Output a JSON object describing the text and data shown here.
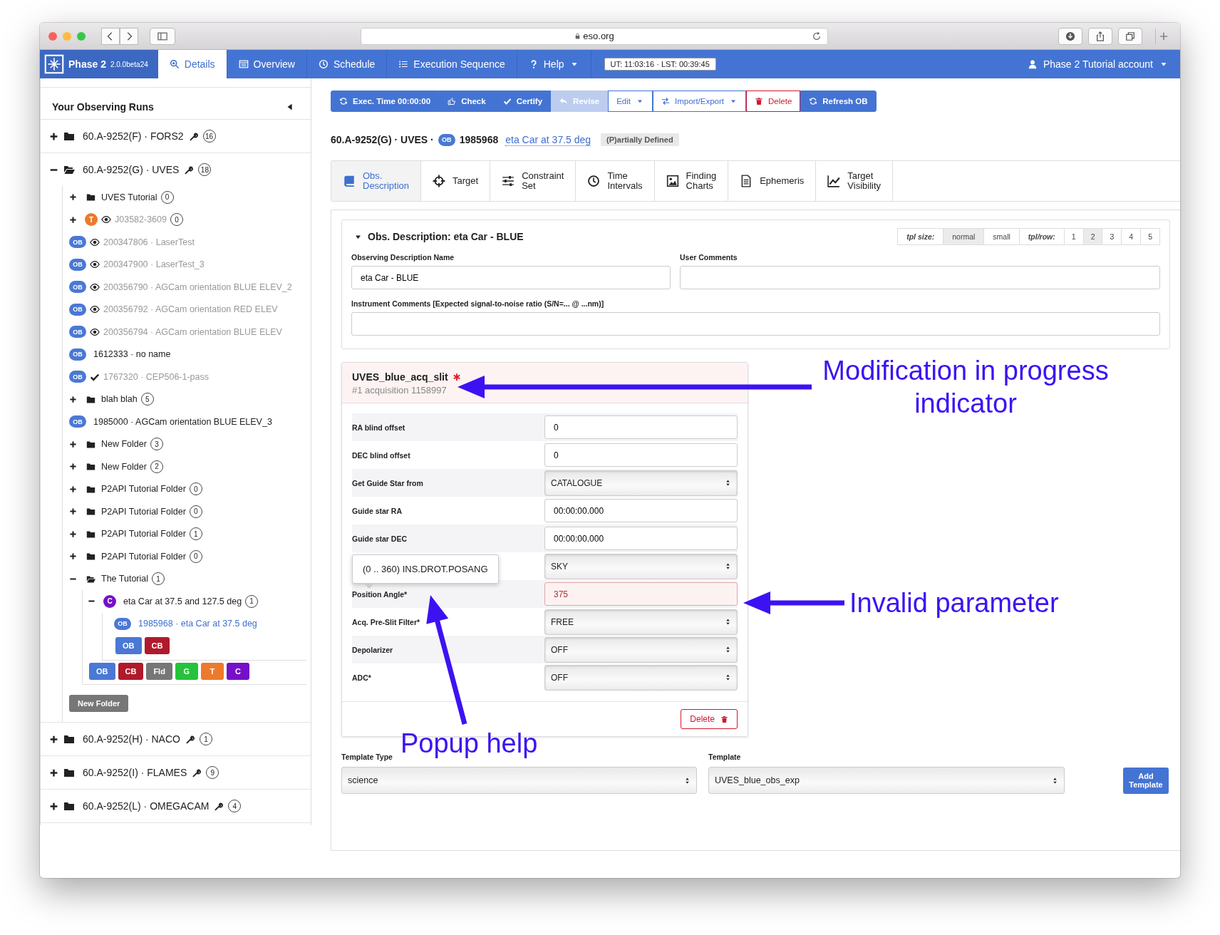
{
  "browser": {
    "url": "eso.org"
  },
  "navbar": {
    "brand": "Phase 2",
    "version": "2.0.0beta24",
    "tabs": [
      {
        "label": "Details",
        "selected": true,
        "dropdown": false
      },
      {
        "label": "Overview",
        "selected": false,
        "dropdown": false
      },
      {
        "label": "Schedule",
        "selected": false,
        "dropdown": false
      },
      {
        "label": "Execution Sequence",
        "selected": false,
        "dropdown": false
      },
      {
        "label": "Help",
        "selected": false,
        "dropdown": true
      }
    ],
    "clock": "UT: 11:03:16 · LST: 00:39:45",
    "account": "Phase 2 Tutorial account"
  },
  "sidebar": {
    "title": "Your Observing Runs",
    "runs": [
      {
        "label": "60.A-9252(F) · FORS2",
        "count": "16",
        "expanded": false
      },
      {
        "label": "60.A-9252(G) · UVES",
        "count": "18",
        "expanded": true,
        "new_folder": "New Folder",
        "children": [
          {
            "kind": "folder",
            "label": "UVES Tutorial",
            "count": "0",
            "expanded": false
          },
          {
            "kind": "container",
            "badge": "T",
            "color": "#ec7a2c",
            "hidden": true,
            "certified": false,
            "greyed": true,
            "label": "J03582-3609",
            "count": "0",
            "expanded": false
          },
          {
            "kind": "ob",
            "badge": "OB",
            "hidden": true,
            "certified": false,
            "greyed": true,
            "selected": false,
            "label": "200347806 · LaserTest"
          },
          {
            "kind": "ob",
            "badge": "OB",
            "hidden": true,
            "certified": false,
            "greyed": true,
            "selected": false,
            "label": "200347900 · LaserTest_3"
          },
          {
            "kind": "ob",
            "badge": "OB",
            "hidden": true,
            "certified": false,
            "greyed": true,
            "selected": false,
            "label": "200356790 · AGCam orientation BLUE ELEV_2"
          },
          {
            "kind": "ob",
            "badge": "OB",
            "hidden": true,
            "certified": false,
            "greyed": true,
            "selected": false,
            "label": "200356792 · AGCam orientation RED ELEV"
          },
          {
            "kind": "ob",
            "badge": "OB",
            "hidden": true,
            "certified": false,
            "greyed": true,
            "selected": false,
            "label": "200356794 · AGCam orientation BLUE ELEV"
          },
          {
            "kind": "ob",
            "badge": "OB",
            "hidden": false,
            "certified": false,
            "greyed": false,
            "selected": false,
            "label": "1612333 · no name"
          },
          {
            "kind": "ob",
            "badge": "OB",
            "hidden": false,
            "certified": true,
            "greyed": true,
            "selected": false,
            "label": "1767320 · CEP506-1-pass"
          },
          {
            "kind": "folder",
            "label": "blah blah",
            "count": "5",
            "expanded": false
          },
          {
            "kind": "ob",
            "badge": "OB",
            "hidden": false,
            "certified": false,
            "greyed": false,
            "selected": false,
            "label": "1985000 · AGCam orientation BLUE ELEV_3"
          },
          {
            "kind": "folder",
            "label": "New Folder",
            "count": "3",
            "expanded": false
          },
          {
            "kind": "folder",
            "label": "New Folder",
            "count": "2",
            "expanded": false
          },
          {
            "kind": "folder",
            "label": "P2API Tutorial Folder",
            "count": "0",
            "expanded": false
          },
          {
            "kind": "folder",
            "label": "P2API Tutorial Folder",
            "count": "0",
            "expanded": false
          },
          {
            "kind": "folder",
            "label": "P2API Tutorial Folder",
            "count": "1",
            "expanded": false
          },
          {
            "kind": "folder",
            "label": "P2API Tutorial Folder",
            "count": "0",
            "expanded": false
          },
          {
            "kind": "folder",
            "label": "The Tutorial",
            "count": "1",
            "expanded": true,
            "children": [
              {
                "kind": "container",
                "badge": "C",
                "color": "#7510c8",
                "hidden": false,
                "certified": false,
                "greyed": false,
                "label": "eta Car at 37.5 and 127.5 deg",
                "count": "1",
                "expanded": true,
                "children": [
                  {
                    "kind": "ob",
                    "badge": "OB",
                    "hidden": false,
                    "certified": false,
                    "greyed": false,
                    "selected": true,
                    "label": "1985968 · eta Car at 37.5 deg"
                  }
                ],
                "buttons": [
                  {
                    "label": "OB",
                    "color": "#4a78d4"
                  },
                  {
                    "label": "CB",
                    "color": "#b01a2c"
                  }
                ]
              }
            ],
            "buttons": [
              {
                "label": "OB",
                "color": "#4a78d4"
              },
              {
                "label": "CB",
                "color": "#b01a2c"
              },
              {
                "label": "Fld",
                "color": "#777777"
              },
              {
                "label": "G",
                "color": "#27c23c"
              },
              {
                "label": "T",
                "color": "#ec7a2c"
              },
              {
                "label": "C",
                "color": "#7510c8"
              }
            ]
          }
        ]
      },
      {
        "label": "60.A-9252(H) · NACO",
        "count": "1",
        "expanded": false
      },
      {
        "label": "60.A-9252(I) · FLAMES",
        "count": "9",
        "expanded": false
      },
      {
        "label": "60.A-9252(L) · OMEGACAM",
        "count": "4",
        "expanded": false
      }
    ]
  },
  "toolbar": [
    {
      "label": "Exec. Time 00:00:00",
      "kind": "primary",
      "disabled": false
    },
    {
      "label": "Check",
      "kind": "primary",
      "disabled": false
    },
    {
      "label": "Certify",
      "kind": "primary",
      "disabled": false
    },
    {
      "label": "Revise",
      "kind": "primary",
      "disabled": true
    },
    {
      "label": "Edit",
      "kind": "dropdown",
      "disabled": false
    },
    {
      "label": "Import/Export",
      "kind": "dropdown",
      "disabled": false
    },
    {
      "label": "Delete",
      "kind": "danger",
      "disabled": false
    },
    {
      "label": "Refresh OB",
      "kind": "primary",
      "disabled": false
    }
  ],
  "header": {
    "run": "60.A-9252(G) · UVES ·",
    "badge": "OB",
    "ob_id": "1985968",
    "ob_name": "eta Car at 37.5 deg",
    "status": "(P)artially Defined"
  },
  "tabs": [
    {
      "label": "Obs. Description",
      "selected": true
    },
    {
      "label": "Target",
      "selected": false
    },
    {
      "label": "Constraint Set",
      "selected": false
    },
    {
      "label": "Time Intervals",
      "selected": false
    },
    {
      "label": "Finding Charts",
      "selected": false
    },
    {
      "label": "Ephemeris",
      "selected": false
    },
    {
      "label": "Target Visibility",
      "selected": false
    }
  ],
  "obs_description": {
    "title": "Obs. Description: eta Car - BLUE",
    "expanded": true,
    "tpl_size": {
      "label": "tpl size:",
      "options": [
        {
          "label": "normal",
          "selected": true
        },
        {
          "label": "small",
          "selected": false
        }
      ]
    },
    "tpl_row": {
      "label": "tpl/row:",
      "options": [
        {
          "label": "1",
          "selected": false
        },
        {
          "label": "2",
          "selected": true
        },
        {
          "label": "3",
          "selected": false
        },
        {
          "label": "4",
          "selected": false
        },
        {
          "label": "5",
          "selected": false
        }
      ]
    },
    "name": {
      "label": "Observing Description Name",
      "value": "eta Car - BLUE"
    },
    "user_comments": {
      "label": "User Comments"
    },
    "instrument_comments": {
      "label": "Instrument Comments [Expected signal-to-noise ratio (S/N=... @ ...nm)]"
    }
  },
  "template": {
    "title": "UVES_blue_acq_slit",
    "modified": true,
    "subtitle": "#1 acquisition 1158997",
    "params": [
      {
        "label": "RA blind offset",
        "kind": "input",
        "value": "0",
        "invalid": false
      },
      {
        "label": "DEC blind offset",
        "kind": "input",
        "value": "0",
        "invalid": false
      },
      {
        "label": "Get Guide Star from",
        "kind": "select",
        "value": "CATALOGUE",
        "invalid": false
      },
      {
        "label": "Guide star RA",
        "kind": "input",
        "value": "00:00:00.000",
        "invalid": false
      },
      {
        "label": "Guide star DEC",
        "kind": "input",
        "value": "00:00:00.000",
        "invalid": false
      },
      {
        "kind": "select",
        "value": "SKY",
        "invalid": false
      },
      {
        "label": "Position Angle*",
        "kind": "input",
        "value": "375",
        "invalid": true,
        "help": "(0 .. 360) INS.DROT.POSANG"
      },
      {
        "label": "Acq. Pre-Slit Filter*",
        "kind": "select",
        "value": "FREE",
        "invalid": false
      },
      {
        "label": "Depolarizer",
        "kind": "select",
        "value": "OFF",
        "invalid": false
      },
      {
        "label": "ADC*",
        "kind": "select",
        "value": "OFF",
        "invalid": false
      }
    ],
    "delete": "Delete"
  },
  "add_template": {
    "type_label": "Template Type",
    "type_value": "science",
    "template_label": "Template",
    "template_value": "UVES_blue_obs_exp",
    "button": "Add Template"
  },
  "annotations": [
    {
      "text": "Modification in progress indicator",
      "kind": "modified"
    },
    {
      "text": "Invalid parameter",
      "kind": "invalid"
    },
    {
      "text": "Popup help",
      "kind": "help"
    }
  ]
}
